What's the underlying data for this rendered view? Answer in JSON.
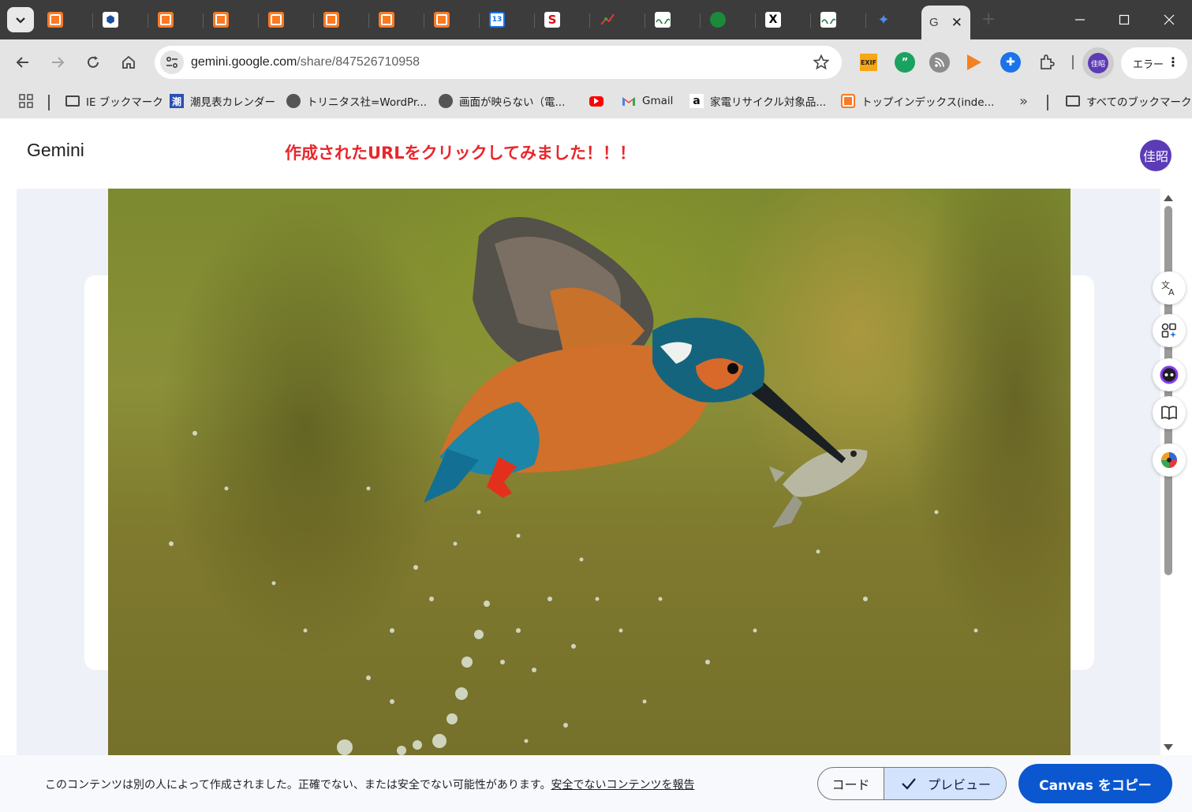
{
  "browser": {
    "tabs": [
      {
        "icon": "xampp-icon",
        "label": ""
      },
      {
        "icon": "cube-icon",
        "label": ""
      },
      {
        "icon": "xampp-icon",
        "label": ""
      },
      {
        "icon": "xampp-icon",
        "label": ""
      },
      {
        "icon": "xampp-icon",
        "label": ""
      },
      {
        "icon": "xampp-icon",
        "label": ""
      },
      {
        "icon": "xampp-icon",
        "label": ""
      },
      {
        "icon": "xampp-icon",
        "label": ""
      },
      {
        "icon": "calendar-icon",
        "label": "13"
      },
      {
        "icon": "red-s-icon",
        "label": "S"
      },
      {
        "icon": "chart-icon",
        "label": ""
      },
      {
        "icon": "site-icon",
        "label": ""
      },
      {
        "icon": "green-globe-icon",
        "label": ""
      },
      {
        "icon": "x-icon",
        "label": "X"
      },
      {
        "icon": "site-icon",
        "label": ""
      },
      {
        "icon": "gemini-star-icon",
        "label": "✦"
      }
    ],
    "active_tab": {
      "icon_letter": "G",
      "close": "✕"
    },
    "address": {
      "host": "gemini.google.com",
      "path": "/share/847526710958"
    },
    "profile_initials": "佳昭",
    "error_label": "エラー",
    "extensions": {
      "exif": "EXIF"
    }
  },
  "bookmarks": {
    "items": [
      {
        "icon": "folder-icon",
        "label": "IE ブックマーク"
      },
      {
        "icon": "tide-icon",
        "label": "潮見表カレンダー",
        "glyph": "潮"
      },
      {
        "icon": "globe-icon",
        "label": "トリニタス社=WordPr..."
      },
      {
        "icon": "globe-icon",
        "label": "画面が映らない（電..."
      },
      {
        "icon": "youtube-icon",
        "label": ""
      },
      {
        "icon": "gmail-icon",
        "label": "Gmail"
      },
      {
        "icon": "amazon-icon",
        "label": "家電リサイクル対象品...",
        "glyph": "a"
      },
      {
        "icon": "xampp-icon",
        "label": "トップインデックス(inde..."
      }
    ],
    "overflow": "»",
    "all_bookmarks": "すべてのブックマーク"
  },
  "page": {
    "title": "Gemini",
    "annotation": "作成されたURLをクリックしてみました！！！",
    "avatar": "佳昭"
  },
  "footer": {
    "disclaimer": "このコンテンツは別の人によって作成されました。正確でない、または安全でない可能性があります。",
    "report_link": "安全でないコンテンツを報告",
    "code_label": "コード",
    "preview_label": "プレビュー",
    "copy_label": "Canvas をコピー"
  },
  "colors": {
    "accent": "#0b57d0",
    "annotation": "#e8262c",
    "avatar": "#5c3bb7",
    "preview_selected": "#d3e3fd"
  }
}
